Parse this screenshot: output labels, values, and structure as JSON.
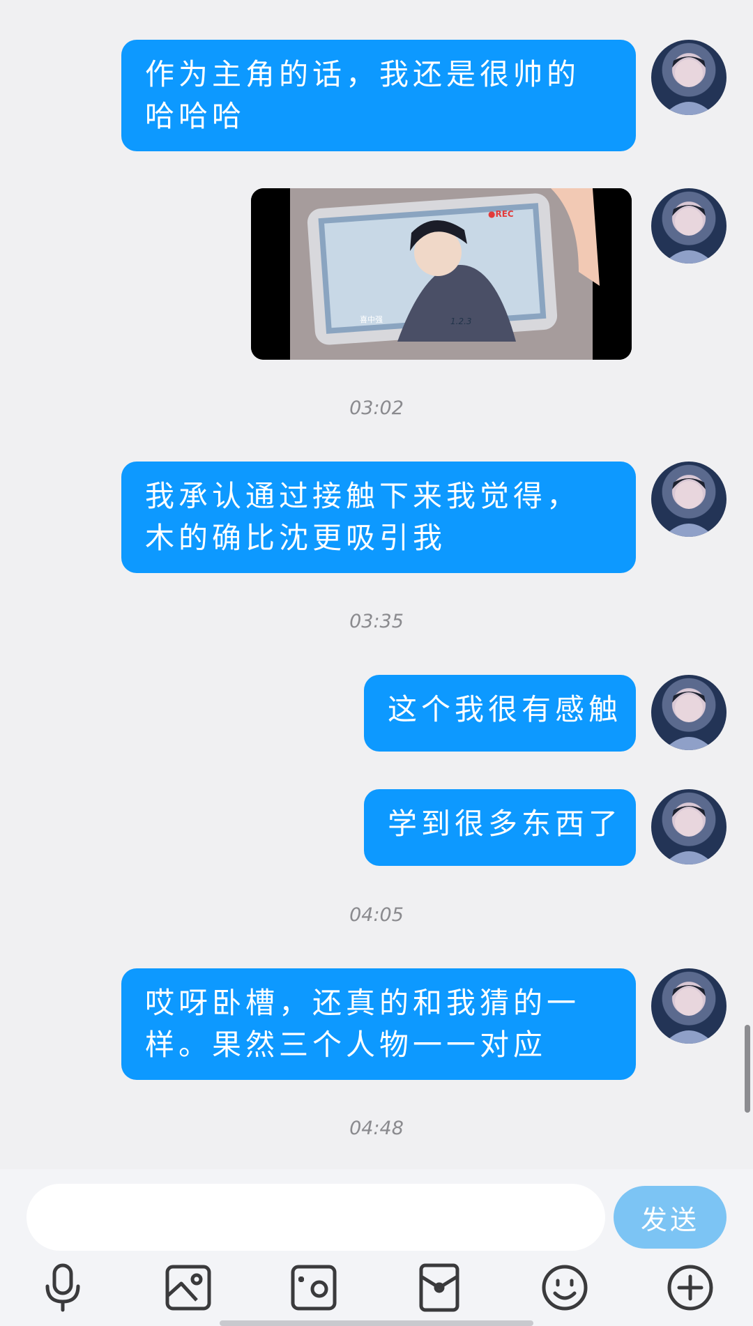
{
  "messages": [
    {
      "type": "text",
      "text": "作为主角的话，我还是很帅的哈哈哈"
    },
    {
      "type": "image"
    },
    {
      "type": "time",
      "text": "03:02"
    },
    {
      "type": "text",
      "text": "我承认通过接触下来我觉得，木的确比沈更吸引我"
    },
    {
      "type": "time",
      "text": "03:35"
    },
    {
      "type": "text",
      "text": "这个我很有感触"
    },
    {
      "type": "text",
      "text": "学到很多东西了"
    },
    {
      "type": "time",
      "text": "04:05"
    },
    {
      "type": "text",
      "text": "哎呀卧槽，还真的和我猜的一样。果然三个人物一一对应"
    },
    {
      "type": "time",
      "text": "04:48"
    }
  ],
  "media": {
    "rec": "●REC",
    "tab_label": "喜中强",
    "hud": "1.2.3"
  },
  "composer": {
    "input_value": "",
    "send_label": "发送"
  },
  "toolbar": {
    "icons": [
      "microphone-icon",
      "image-icon",
      "camera-icon",
      "red-packet-icon",
      "emoji-icon",
      "plus-icon"
    ]
  },
  "colors": {
    "bubble": "#0d99ff",
    "send_button": "#7cc4f4",
    "background": "#f0f0f2"
  }
}
